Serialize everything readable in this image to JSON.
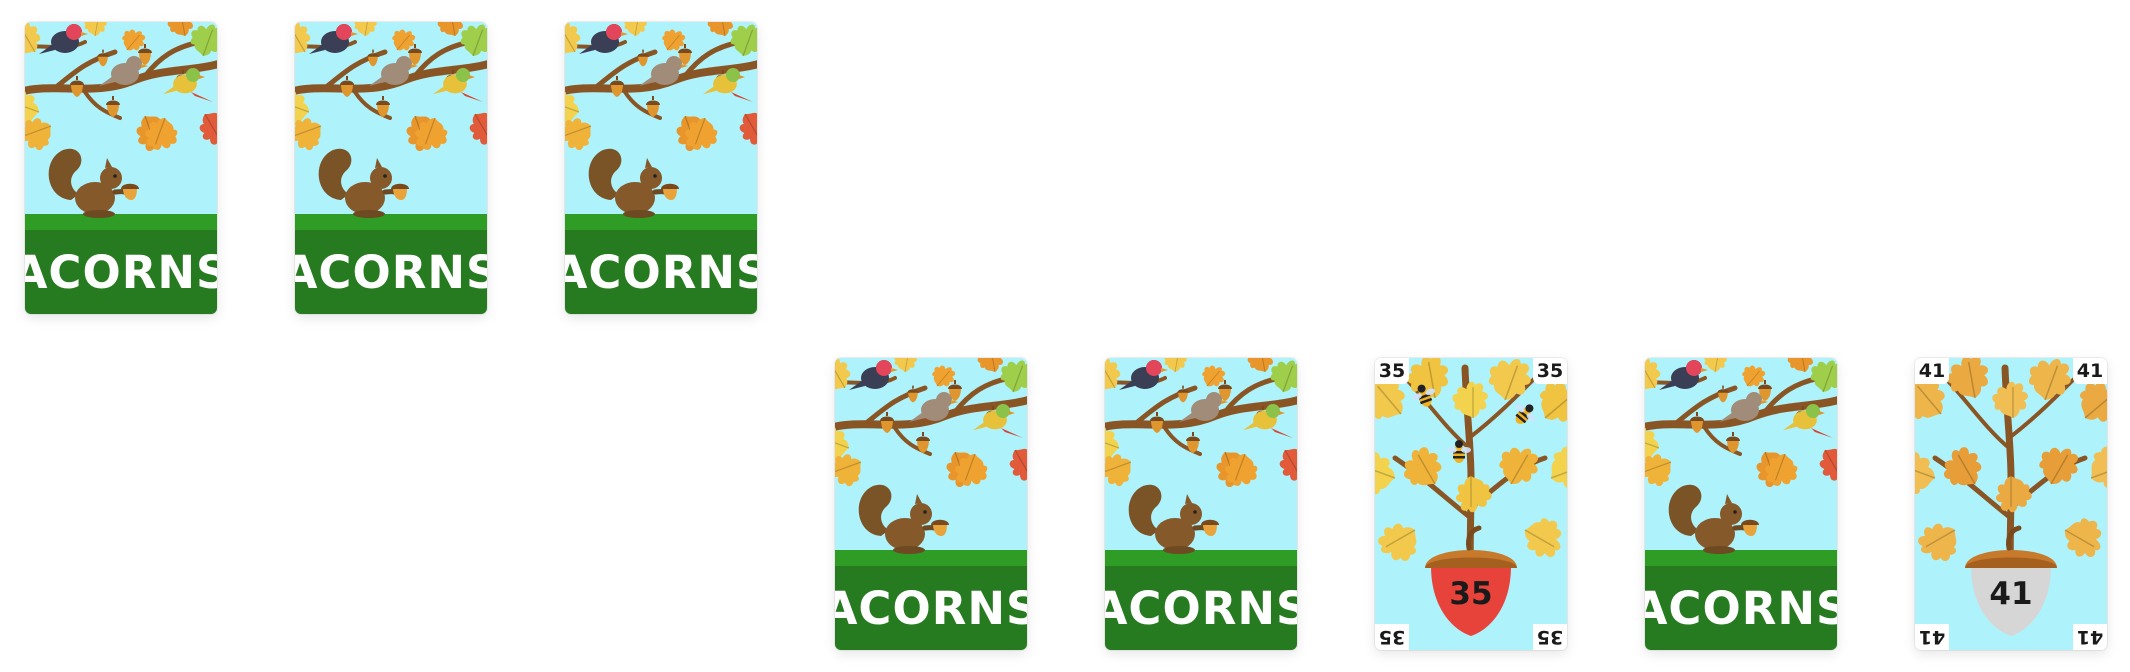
{
  "card_back": {
    "label": "ACORNS"
  },
  "top_row": [
    {
      "face": "back"
    },
    {
      "face": "back"
    },
    {
      "face": "back"
    }
  ],
  "bottom_row": [
    {
      "face": "back"
    },
    {
      "face": "back"
    },
    {
      "face": "front",
      "value": "35",
      "acorn_color": "#e8433a"
    },
    {
      "face": "back"
    },
    {
      "face": "front",
      "value": "41",
      "acorn_color": "#d6d6d6"
    }
  ]
}
